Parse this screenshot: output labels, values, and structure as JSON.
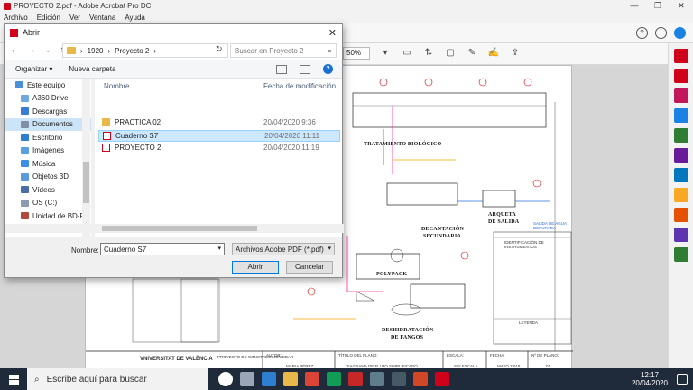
{
  "window": {
    "title": "PROYECTO 2.pdf - Adobe Acrobat Pro DC",
    "controls": [
      "—",
      "❐",
      "✕"
    ]
  },
  "menu": [
    "Archivo",
    "Edición",
    "Ver",
    "Ventana",
    "Ayuda"
  ],
  "toolbar": {
    "help": "?",
    "zoom": "50%"
  },
  "drawing": {
    "labels": {
      "bio": "TRATAMIENTO BIOLÓGICO",
      "decant1": "DECANTACIÓN",
      "decant2": "SECUNDARIA",
      "arq1": "ARQUETA",
      "arq2": "DE SALIDA",
      "poly": "POLYPACK",
      "deshid1": "DESHIDRATACIÓN",
      "deshid2": "DE FANGOS",
      "salida": "SALIDA DE AGUA DEPURADA",
      "ident": "IDENTIFICACIÓN DE INSTRUMENTOS",
      "leyenda": "LEYENDA"
    },
    "title_block": {
      "logo": "VNIVERSITAT DE VALÈNCIA",
      "project": "PROYECTO DE CONSTRUCCIÓN EDAR",
      "autor_label": "AUTOR:",
      "autor": "MARIA PÉREZ",
      "titulo_label": "TÍTULO DEL PLANO:",
      "titulo": "DIAGRAMA DE FLUJO SIMPLIFICADO",
      "escala_label": "ESCALA:",
      "escala": "SIN ESCALA",
      "fecha_label": "FECHA:",
      "fecha": "MAYO 2.018",
      "plano_label": "Nº DE PLANO:",
      "plano": "01"
    }
  },
  "dialog": {
    "title": "Abrir",
    "close": "✕",
    "nav": {
      "back": "←",
      "forward": "→",
      "recent": "⌄",
      "up": "↑"
    },
    "breadcrumb": [
      "1920",
      "Proyecto 2"
    ],
    "sep": "›",
    "refresh": "↻",
    "search_placeholder": "Buscar en Proyecto 2",
    "search_icon": "⌕",
    "organize": "Organizar ▾",
    "new_folder": "Nueva carpeta",
    "help": "?",
    "nav_items": [
      {
        "label": "Este equipo",
        "icon": "computer-icon",
        "color": "#4a90d9"
      },
      {
        "label": "A360 Drive",
        "icon": "cloud-drive-icon",
        "color": "#6fa8dc"
      },
      {
        "label": "Descargas",
        "icon": "downloads-icon",
        "color": "#3a7bd5"
      },
      {
        "label": "Documentos",
        "icon": "documents-icon",
        "color": "#7e8fa6"
      },
      {
        "label": "Escritorio",
        "icon": "desktop-icon",
        "color": "#2f7fd1"
      },
      {
        "label": "Imágenes",
        "icon": "pictures-icon",
        "color": "#5aa0e0"
      },
      {
        "label": "Música",
        "icon": "music-icon",
        "color": "#3d8ee6"
      },
      {
        "label": "Objetos 3D",
        "icon": "3d-objects-icon",
        "color": "#5a9bd8"
      },
      {
        "label": "Vídeos",
        "icon": "videos-icon",
        "color": "#4a6fa5"
      },
      {
        "label": "OS (C:)",
        "icon": "drive-icon",
        "color": "#8a9bb0"
      },
      {
        "label": "Unidad de BD-R",
        "icon": "bd-drive-icon",
        "color": "#b04a3a"
      },
      {
        "label": "Red",
        "icon": "network-icon",
        "color": "#4a7fc1"
      }
    ],
    "columns": {
      "name": "Nombre",
      "date": "Fecha de modificación"
    },
    "files": [
      {
        "name": "PRACTICA 02",
        "date": "20/04/2020 9:36",
        "type": "folder"
      },
      {
        "name": "Cuaderno S7",
        "date": "20/04/2020 11:11",
        "type": "pdf",
        "selected": true
      },
      {
        "name": "PROYECTO 2",
        "date": "20/04/2020 11:19",
        "type": "pdf"
      }
    ],
    "filename_label": "Nombre:",
    "filename": "Cuaderno S7",
    "filetype": "Archivos Adobe PDF (*.pdf)",
    "open_button": "Abrir",
    "cancel_button": "Cancelar"
  },
  "taskbar": {
    "search": "Escribe aquí para buscar",
    "time": "12:17",
    "date": "20/04/2020",
    "apps": [
      {
        "name": "cortana-icon",
        "color": "#ffffff"
      },
      {
        "name": "task-view-icon",
        "color": "#9aa5b5"
      },
      {
        "name": "edge-icon",
        "color": "#2f7fd1"
      },
      {
        "name": "explorer-icon",
        "color": "#e8b84a"
      },
      {
        "name": "chrome-icon",
        "color": "#db4437"
      },
      {
        "name": "app-icon",
        "color": "#0f9d58"
      },
      {
        "name": "autocad-icon",
        "color": "#c62828"
      },
      {
        "name": "app2-icon",
        "color": "#607d8b"
      },
      {
        "name": "app3-icon",
        "color": "#455a64"
      },
      {
        "name": "powerpoint-icon",
        "color": "#d24726"
      },
      {
        "name": "acrobat-icon",
        "color": "#d0021b"
      }
    ]
  },
  "right_tools": [
    {
      "name": "export-pdf-icon",
      "color": "#d0021b"
    },
    {
      "name": "create-pdf-icon",
      "color": "#d0021b"
    },
    {
      "name": "edit-pdf-icon",
      "color": "#c2185b"
    },
    {
      "name": "combine-icon",
      "color": "#1a82e2"
    },
    {
      "name": "organize-icon",
      "color": "#2e7d32"
    },
    {
      "name": "fill-sign-icon",
      "color": "#6a1b9a"
    },
    {
      "name": "send-icon",
      "color": "#0277bd"
    },
    {
      "name": "comment-icon",
      "color": "#f9a825"
    },
    {
      "name": "scan-icon",
      "color": "#e65100"
    },
    {
      "name": "protect-icon",
      "color": "#5e35b1"
    },
    {
      "name": "more-tools-icon",
      "color": "#2e7d32"
    }
  ]
}
